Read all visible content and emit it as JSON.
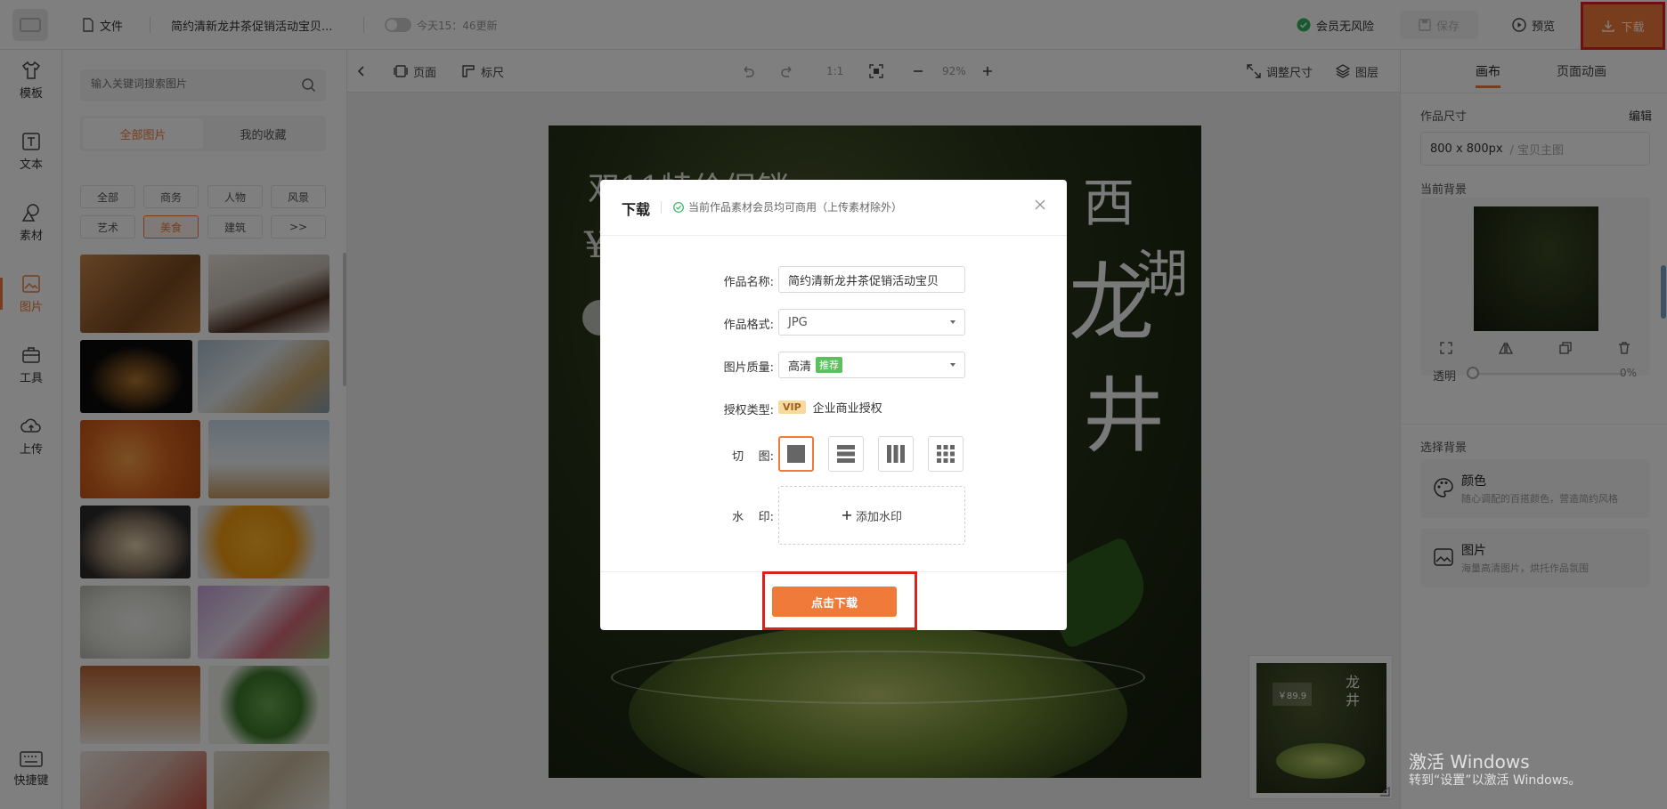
{
  "topbar": {
    "file_label": "文件",
    "doc_title": "简约清新龙井茶促销活动宝贝...",
    "autosave_status": "今天15：46更新",
    "member_status": "会员无风险",
    "save_label": "保存",
    "preview_label": "预览",
    "download_label": "下载"
  },
  "rail": {
    "items": [
      {
        "label": "模板",
        "icon": "shirt-icon"
      },
      {
        "label": "文本",
        "icon": "text-icon"
      },
      {
        "label": "素材",
        "icon": "shapes-icon"
      },
      {
        "label": "图片",
        "icon": "image-icon"
      },
      {
        "label": "工具",
        "icon": "toolbox-icon"
      },
      {
        "label": "上传",
        "icon": "cloud-upload-icon"
      }
    ],
    "shortcut_label": "快捷键",
    "active": "图片"
  },
  "image_panel": {
    "search_placeholder": "输入关键词搜索图片",
    "tabs": [
      "全部图片",
      "我的收藏"
    ],
    "active_tab": "全部图片",
    "categories": [
      "全部",
      "商务",
      "人物",
      "风景",
      "艺术",
      "美食",
      "建筑",
      ">>"
    ],
    "active_category": "美食"
  },
  "canvas_toolbar": {
    "page_label": "页面",
    "ruler_label": "标尺",
    "ratio_label": "1:1",
    "zoom": "92%",
    "resize_label": "调整尺寸",
    "layers_label": "图层"
  },
  "artboard": {
    "headline_partial": "双11特价促销",
    "title_chars": [
      "西",
      "湖",
      "龙",
      "井"
    ],
    "minimap_price": "￥89.9"
  },
  "right_panel": {
    "tabs": [
      "画布",
      "页面动画"
    ],
    "active_tab": "画布",
    "size_label": "作品尺寸",
    "edit_label": "编辑",
    "size_value": "800 x 800px",
    "size_name": "/ 宝贝主图",
    "current_bg_label": "当前背景",
    "opacity_label": "透明",
    "opacity_value": "0%",
    "choose_bg_label": "选择背景",
    "options": [
      {
        "title": "颜色",
        "subtitle": "随心调配的百搭颜色，营造简约风格"
      },
      {
        "title": "图片",
        "subtitle": "海量高清图片，烘托作品氛围"
      }
    ]
  },
  "dialog": {
    "title": "下载",
    "note": "当前作品素材会员均可商用（上传素材除外）",
    "fields": {
      "name_label": "作品名称:",
      "name_value": "简约清新龙井茶促销活动宝贝",
      "format_label": "作品格式:",
      "format_value": "JPG",
      "quality_label": "图片质量:",
      "quality_value": "高清",
      "quality_badge": "推荐",
      "license_label": "授权类型:",
      "license_badge": "VIP",
      "license_value": "企业商业授权",
      "slice_label": "切    图:",
      "watermark_label": "水    印:",
      "watermark_button": "添加水印"
    },
    "slice_options": [
      "none",
      "horizontal",
      "vertical",
      "grid"
    ],
    "active_slice": "none",
    "confirm_label": "点击下载"
  },
  "os_watermark": {
    "line1": "激活 Windows",
    "line2": "转到“设置”以激活 Windows。"
  },
  "colors": {
    "accent": "#f07a3a",
    "highlight": "#d9221b",
    "success": "#2db55d",
    "recommend": "#5cc05c"
  }
}
